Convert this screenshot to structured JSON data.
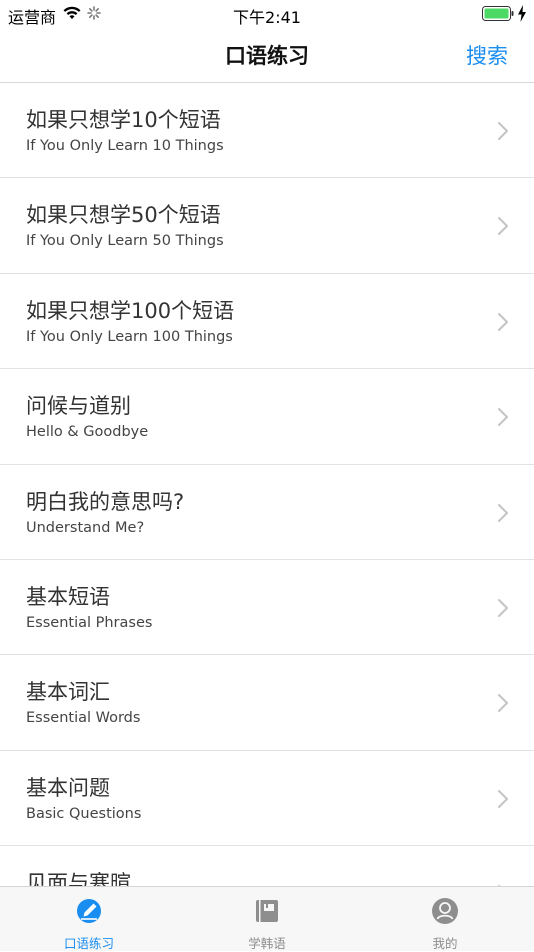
{
  "status_bar": {
    "carrier": "运营商",
    "time": "下午2:41",
    "battery_color": "#4cd964"
  },
  "nav": {
    "title": "口语练习",
    "search_label": "搜索",
    "accent_color": "#1a8df0"
  },
  "list": {
    "items": [
      {
        "title": "如果只想学10个短语",
        "subtitle": "If You Only Learn 10 Things"
      },
      {
        "title": "如果只想学50个短语",
        "subtitle": "If You Only Learn 50 Things"
      },
      {
        "title": "如果只想学100个短语",
        "subtitle": "If You Only Learn 100 Things"
      },
      {
        "title": "问候与道别",
        "subtitle": "Hello & Goodbye"
      },
      {
        "title": "明白我的意思吗?",
        "subtitle": "Understand Me?"
      },
      {
        "title": "基本短语",
        "subtitle": "Essential Phrases"
      },
      {
        "title": "基本词汇",
        "subtitle": "Essential Words"
      },
      {
        "title": "基本问题",
        "subtitle": "Basic Questions"
      },
      {
        "title": "见面与寒暄",
        "subtitle": ""
      }
    ]
  },
  "tab_bar": {
    "tabs": [
      {
        "label": "口语练习",
        "icon": "pencil-icon",
        "active": true
      },
      {
        "label": "学韩语",
        "icon": "book-icon",
        "active": false
      },
      {
        "label": "我的",
        "icon": "profile-icon",
        "active": false
      }
    ]
  }
}
